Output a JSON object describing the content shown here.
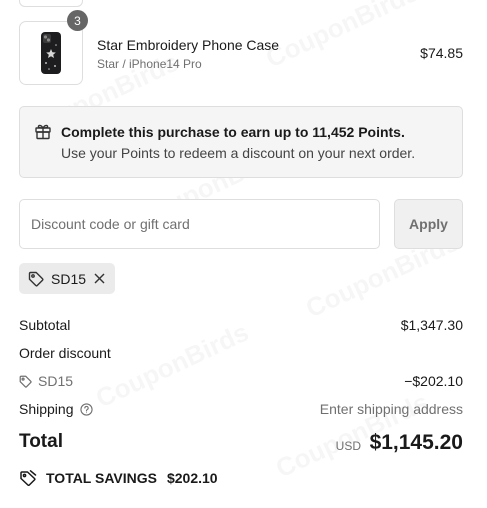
{
  "product": {
    "quantity": "3",
    "name": "Star Embroidery Phone Case",
    "variant": "Star / iPhone14 Pro",
    "price": "$74.85"
  },
  "points": {
    "title": "Complete this purchase to earn up to 11,452 Points.",
    "subtitle": "Use your Points to redeem a discount on your next order."
  },
  "discount": {
    "placeholder": "Discount code or gift card",
    "apply_label": "Apply",
    "applied_code": "SD15"
  },
  "summary": {
    "subtotal_label": "Subtotal",
    "subtotal_value": "$1,347.30",
    "order_discount_label": "Order discount",
    "discount_code": "SD15",
    "discount_value": "−$202.10",
    "shipping_label": "Shipping",
    "shipping_value": "Enter shipping address",
    "total_label": "Total",
    "currency": "USD",
    "total_value": "$1,145.20",
    "savings_label": "TOTAL SAVINGS",
    "savings_value": "$202.10"
  },
  "watermark": "CouponBirds",
  "icons": [
    "phone-case-image",
    "gift-icon",
    "tag-icon",
    "close-icon",
    "help-circle-icon",
    "savings-tag-icon"
  ]
}
